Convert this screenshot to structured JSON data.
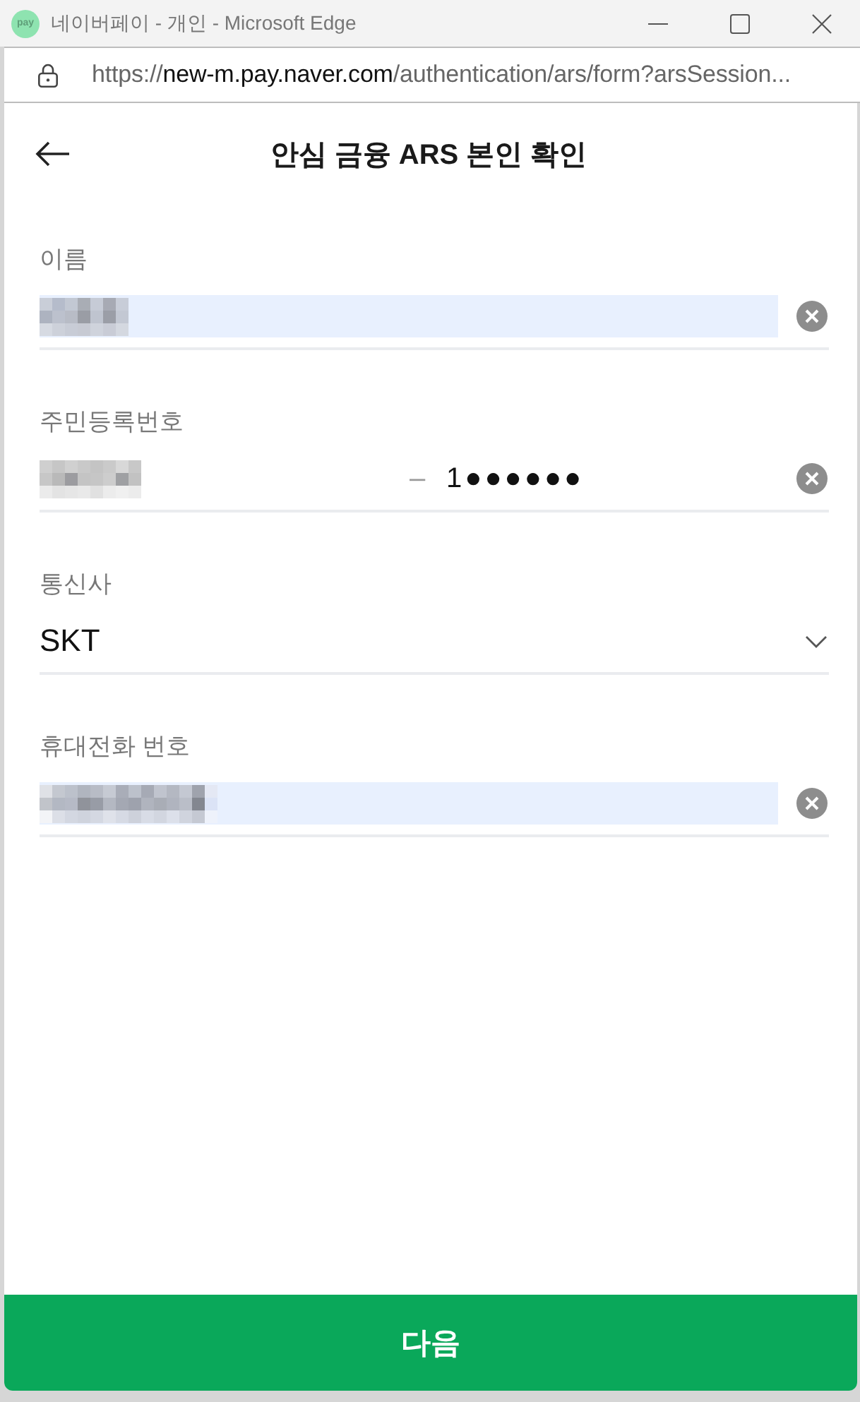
{
  "window": {
    "icon_text": "pay",
    "title": "네이버페이 - 개인 - Microsoft Edge"
  },
  "address_bar": {
    "scheme": "https://",
    "host": "new-m.pay.naver.com",
    "path": "/authentication/ars/form?arsSession..."
  },
  "page": {
    "title": "안심 금융 ARS 본인 확인"
  },
  "fields": [
    {
      "kind": "text",
      "label": "이름",
      "redacted": true,
      "autofilled": true,
      "clearable": true
    },
    {
      "kind": "resident-id",
      "label": "주민등록번호",
      "redacted": true,
      "autofilled": false,
      "separator": "–",
      "back_value": "1●●●●●●",
      "clearable": true
    },
    {
      "kind": "select",
      "label": "통신사",
      "value": "SKT"
    },
    {
      "kind": "text",
      "label": "휴대전화 번호",
      "redacted": true,
      "autofilled": true,
      "clearable": true
    }
  ],
  "submit_button": {
    "label": "다음"
  }
}
